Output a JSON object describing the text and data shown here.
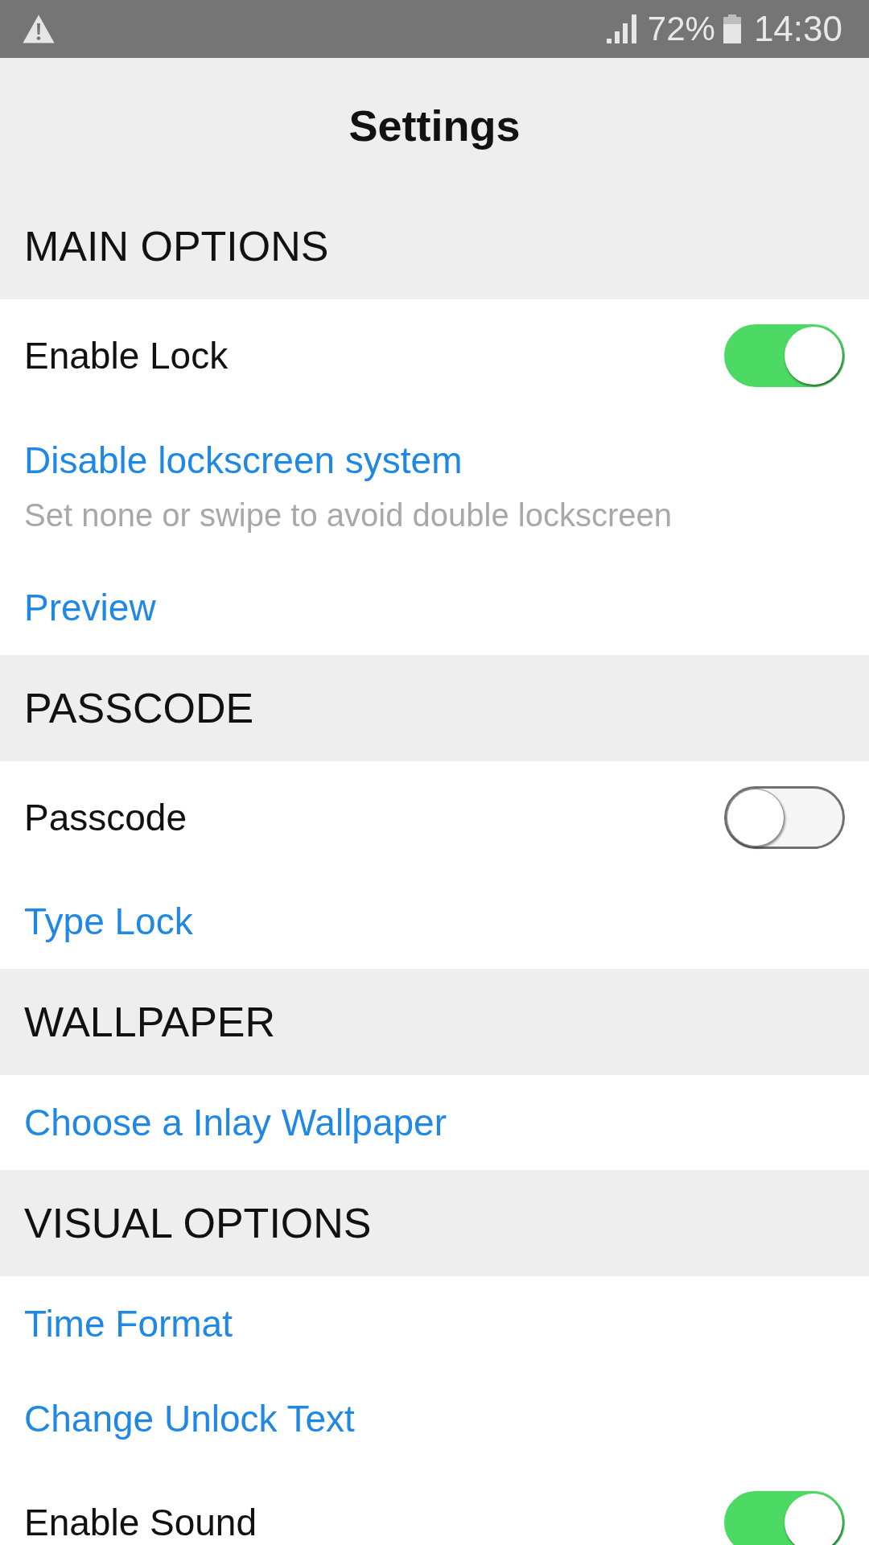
{
  "status_bar": {
    "battery": "72%",
    "time": "14:30"
  },
  "title": "Settings",
  "sections": [
    {
      "header": "MAIN OPTIONS",
      "items": [
        {
          "kind": "toggle",
          "label": "Enable Lock",
          "on": true
        },
        {
          "kind": "link",
          "label": "Disable lockscreen system",
          "subtitle": "Set none or swipe to avoid double lockscreen"
        },
        {
          "kind": "link",
          "label": "Preview"
        }
      ]
    },
    {
      "header": "PASSCODE",
      "items": [
        {
          "kind": "toggle",
          "label": "Passcode",
          "on": false
        },
        {
          "kind": "link",
          "label": "Type Lock"
        }
      ]
    },
    {
      "header": "WALLPAPER",
      "items": [
        {
          "kind": "link",
          "label": "Choose a Inlay Wallpaper"
        }
      ]
    },
    {
      "header": "VISUAL OPTIONS",
      "items": [
        {
          "kind": "link",
          "label": "Time Format"
        },
        {
          "kind": "link",
          "label": "Change Unlock Text"
        },
        {
          "kind": "toggle",
          "label": "Enable Sound",
          "on": true
        }
      ]
    }
  ]
}
